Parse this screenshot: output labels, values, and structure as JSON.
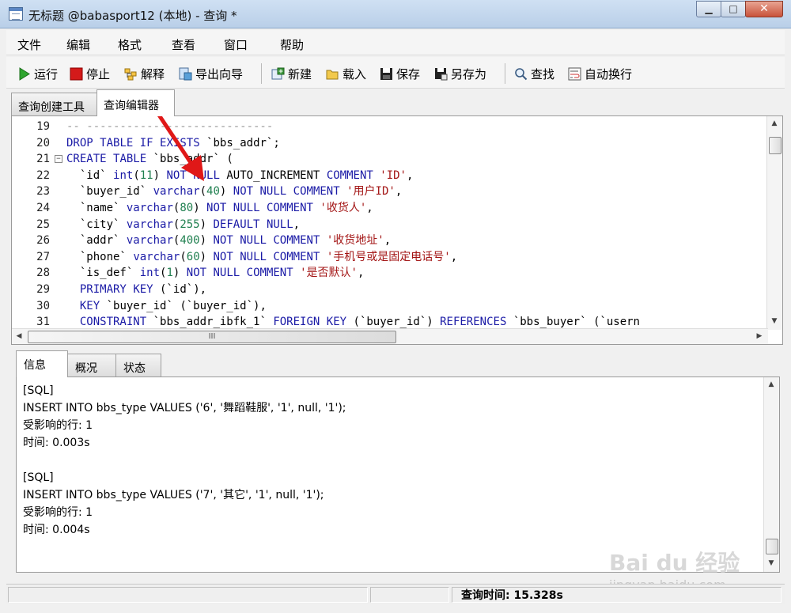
{
  "window": {
    "title": "无标题 @babasport12 (本地) - 查询 *",
    "controls": {
      "minimize": "▁",
      "maximize": "□",
      "close": "✕"
    }
  },
  "menu": [
    "文件",
    "编辑",
    "格式",
    "查看",
    "窗口",
    "帮助"
  ],
  "toolbar": [
    {
      "label": "运行",
      "icon": "play-icon"
    },
    {
      "label": "停止",
      "icon": "stop-icon"
    },
    {
      "label": "解释",
      "icon": "explain-icon"
    },
    {
      "label": "导出向导",
      "icon": "export-icon"
    },
    {
      "label": "新建",
      "icon": "new-icon"
    },
    {
      "label": "载入",
      "icon": "folder-open-icon"
    },
    {
      "label": "保存",
      "icon": "save-icon"
    },
    {
      "label": "另存为",
      "icon": "save-as-icon"
    },
    {
      "label": "查找",
      "icon": "search-icon"
    },
    {
      "label": "自动换行",
      "icon": "wrap-icon"
    }
  ],
  "editor_tabs": [
    "查询创建工具",
    "查询编辑器"
  ],
  "editor": {
    "lines": [
      {
        "n": "19",
        "t": "-- ----------------------------"
      },
      {
        "n": "20",
        "t": "DROP TABLE IF EXISTS `bbs_addr`;"
      },
      {
        "n": "21",
        "t": "CREATE TABLE `bbs_addr` ("
      },
      {
        "n": "22",
        "t": "  `id` int(11) NOT NULL AUTO_INCREMENT COMMENT 'ID',"
      },
      {
        "n": "23",
        "t": "  `buyer_id` varchar(40) NOT NULL COMMENT '用户ID',"
      },
      {
        "n": "24",
        "t": "  `name` varchar(80) NOT NULL COMMENT '收货人',"
      },
      {
        "n": "25",
        "t": "  `city` varchar(255) DEFAULT NULL,"
      },
      {
        "n": "26",
        "t": "  `addr` varchar(400) NOT NULL COMMENT '收货地址',"
      },
      {
        "n": "27",
        "t": "  `phone` varchar(60) NOT NULL COMMENT '手机号或是固定电话号',"
      },
      {
        "n": "28",
        "t": "  `is_def` int(1) NOT NULL COMMENT '是否默认',"
      },
      {
        "n": "29",
        "t": "  PRIMARY KEY (`id`),"
      },
      {
        "n": "30",
        "t": "  KEY `buyer_id` (`buyer_id`),"
      },
      {
        "n": "31",
        "t": "  CONSTRAINT `bbs_addr_ibfk_1` FOREIGN KEY (`buyer_id`) REFERENCES `bbs_buyer` (`usern"
      }
    ],
    "hscroll_glyph": "III"
  },
  "bottom_tabs": [
    "信息",
    "概况",
    "状态"
  ],
  "info": [
    "[SQL]",
    "INSERT INTO bbs_type VALUES ('6', '舞蹈鞋服', '1', null, '1');",
    "受影响的行: 1",
    "时间: 0.003s",
    "",
    "[SQL]",
    "INSERT INTO bbs_type VALUES ('7', '其它', '1', null, '1');",
    "受影响的行: 1",
    "时间: 0.004s"
  ],
  "status": {
    "query_time": "查询时间: 15.328s"
  },
  "watermark": {
    "brand": "Bai du 经验",
    "url": "jingyan.baidu.com"
  }
}
